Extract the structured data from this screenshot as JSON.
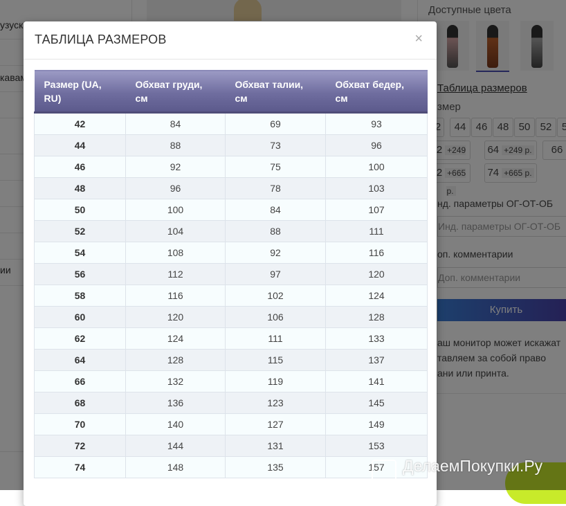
{
  "background": {
    "left_menu": [
      "узуск",
      "кавам",
      "",
      "",
      "",
      "",
      "ии"
    ],
    "right_panel": {
      "colors_title": "Доступные цвета",
      "size_table_link": "Таблица размеров",
      "size_label": "змер",
      "sizes": [
        "2",
        "44",
        "46",
        "48",
        "50",
        "52",
        "5"
      ],
      "sizes_priced": [
        {
          "size": "2",
          "price": "+249 р."
        },
        {
          "size": "64",
          "price": "+249 р."
        },
        {
          "size": "66",
          "price": ""
        },
        {
          "size": "2",
          "price": "+665 р."
        },
        {
          "size": "74",
          "price": "+665 р."
        }
      ],
      "params_label": "нд. параметры ОГ-ОТ-ОБ",
      "params_placeholder": "Инд. параметры ОГ-ОТ-ОБ",
      "comment_label": "оп. комментарии",
      "comment_placeholder": "Доп. комментарии",
      "buy_label": "Купить",
      "note_lines": [
        "аш монитор может искажат",
        "тавляем за собой право",
        "ани или принта."
      ]
    }
  },
  "modal": {
    "title": "ТАБЛИЦА РАЗМЕРОВ",
    "close": "×",
    "columns": [
      "Размер (UA, RU)",
      "Обхват груди, см",
      "Обхват талии, см",
      "Обхват бедер, см"
    ],
    "rows": [
      [
        "42",
        "84",
        "69",
        "93"
      ],
      [
        "44",
        "88",
        "73",
        "96"
      ],
      [
        "46",
        "92",
        "75",
        "100"
      ],
      [
        "48",
        "96",
        "78",
        "103"
      ],
      [
        "50",
        "100",
        "84",
        "107"
      ],
      [
        "52",
        "104",
        "88",
        "111"
      ],
      [
        "54",
        "108",
        "92",
        "116"
      ],
      [
        "56",
        "112",
        "97",
        "120"
      ],
      [
        "58",
        "116",
        "102",
        "124"
      ],
      [
        "60",
        "120",
        "106",
        "128"
      ],
      [
        "62",
        "124",
        "111",
        "133"
      ],
      [
        "64",
        "128",
        "115",
        "137"
      ],
      [
        "66",
        "132",
        "119",
        "141"
      ],
      [
        "68",
        "136",
        "123",
        "145"
      ],
      [
        "70",
        "140",
        "127",
        "149"
      ],
      [
        "72",
        "144",
        "131",
        "153"
      ],
      [
        "74",
        "148",
        "135",
        "157"
      ]
    ]
  },
  "watermark": "ДелаемПокупки.Ру",
  "colors": {
    "header": "#6f6d9f",
    "buy": "#4a3ea8",
    "accent_green": "#c8ea2a"
  }
}
